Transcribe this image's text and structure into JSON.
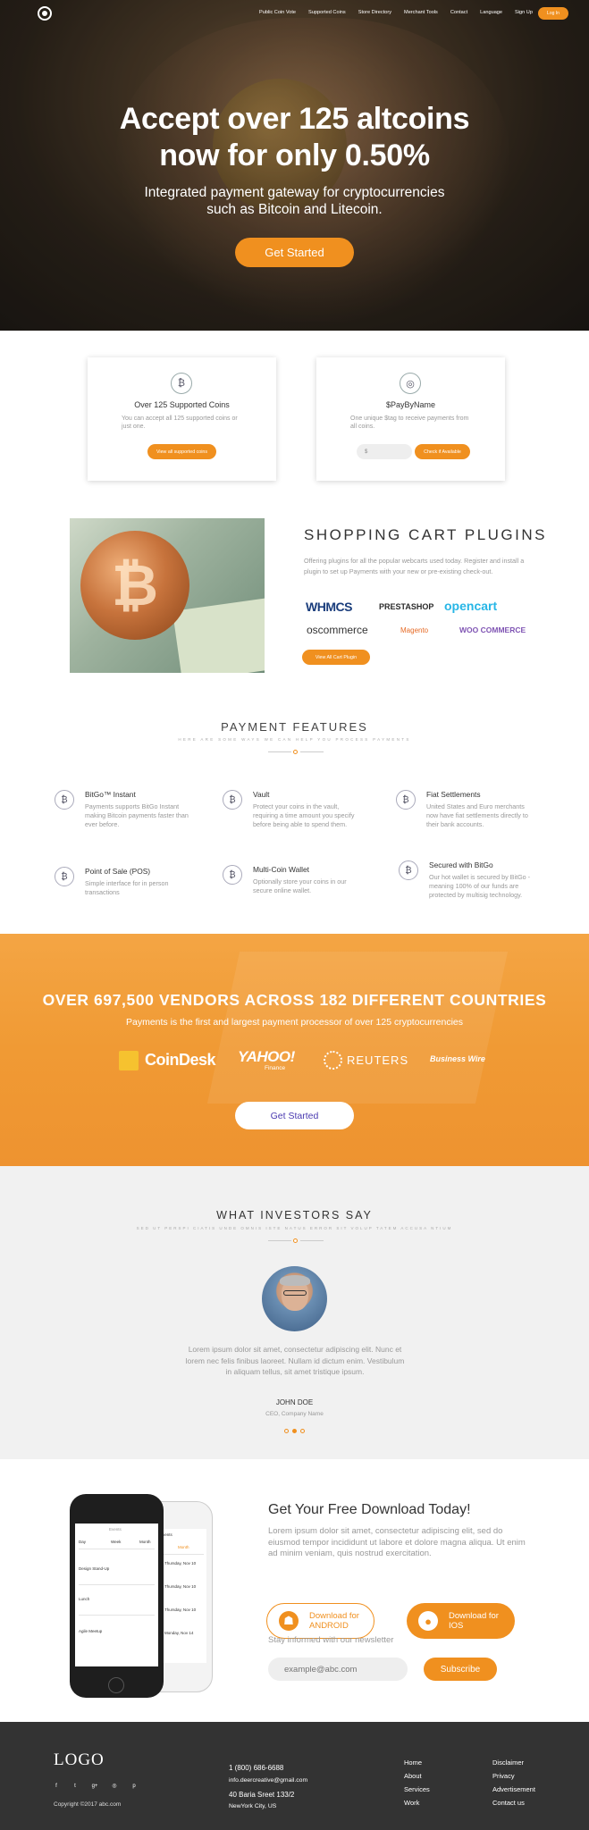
{
  "nav": {
    "links": [
      "Public Coin Vote",
      "Supported Coins",
      "Store Directory",
      "Merchant Tools",
      "Contact",
      "Language",
      "Sign Up"
    ],
    "login": "Log In"
  },
  "hero": {
    "title_line1": "Accept over 125 altcoins",
    "title_line2": "now for only 0.50%",
    "sub_line1": "Integrated payment gateway for cryptocurrencies",
    "sub_line2": "such as Bitcoin and Litecoin.",
    "cta": "Get Started"
  },
  "cards": [
    {
      "icon": "₿",
      "title": "Over 125 Supported Coins",
      "desc": "You can accept all 125 supported coins or just one.",
      "button": "View all supported coins"
    },
    {
      "icon": "◎",
      "title": "$PayByName",
      "desc": "One unique $tag to receive payments from all coins.",
      "field": "$",
      "button": "Check if Available"
    }
  ],
  "cart": {
    "title": "SHOPPING CART PLUGINS",
    "text": "Offering plugins for all the popular webcarts used today. Register and install a plugin to set up Payments with your new or pre-existing check-out.",
    "brands": [
      "WHMCS",
      "PRESTASHOP",
      "opencart",
      "oscommerce",
      "Magento",
      "WOO COMMERCE"
    ],
    "button": "View All Cart Plugin"
  },
  "features": {
    "title": "PAYMENT FEATURES",
    "subtitle": "HERE ARE SOME WAYS WE CAN HELP YOU PROCESS PAYMENTS",
    "items": [
      {
        "title": "BitGo™ Instant",
        "desc": "Payments supports BitGo Instant making Bitcoin payments faster than ever before."
      },
      {
        "title": "Vault",
        "desc": "Protect your coins in the vault, requiring a time amount you specify before being able to spend them."
      },
      {
        "title": "Fiat Settlements",
        "desc": "United States and Euro merchants now have fiat settlements directly to their bank accounts."
      },
      {
        "title": "Point of Sale (POS)",
        "desc": "Simple interface for in person transactions"
      },
      {
        "title": "Multi-Coin Wallet",
        "desc": "Optionally store your coins in our secure online wallet."
      },
      {
        "title": "Secured with BitGo",
        "desc": "Our hot wallet is secured by BitGo - meaning 100% of our funds are protected by multisig technology."
      }
    ]
  },
  "band": {
    "title": "OVER 697,500 VENDORS ACROSS 182 DIFFERENT COUNTRIES",
    "sub": "Payments is the first and largest payment processor of over 125 cryptocurrencies",
    "press": [
      "CoinDesk",
      "YAHOO!",
      "Finance",
      "REUTERS",
      "Business Wire"
    ],
    "cta": "Get Started"
  },
  "investors": {
    "title": "WHAT INVESTORS SAY",
    "subtitle": "SED UT PERSPI CIATIS UNDE OMNIS ISTE NATUS ERROR SIT VOLUP TATEM ACCUSA NTIUM",
    "quote": "Lorem ipsum dolor sit amet, consectetur adipiscing elit. Nunc et lorem nec felis finibus laoreet. Nullam id dictum enim. Vestibulum in aliquam tellus, sit amet tristique ipsum.",
    "name": "JOHN DOE",
    "role": "CEO, Company Name"
  },
  "phone_app": {
    "header": "Events",
    "tabs": [
      "Day",
      "Week",
      "Month"
    ],
    "rows": [
      "Design Stand-Up",
      "Lunch",
      "Agile Meetup"
    ],
    "back_rows": [
      "Thursday, Nov 10",
      "Thursday, Nov 10",
      "Thursday, Nov 10",
      "Monday, Nov 14"
    ]
  },
  "download": {
    "title": "Get Your Free Download Today!",
    "text": "Lorem ipsum dolor sit amet, consectetur adipiscing elit, sed do eiusmod tempor incididunt ut labore et dolore magna aliqua. Ut enim ad minim veniam, quis nostrud exercitation.",
    "android_l1": "Download for",
    "android_l2": "ANDROID",
    "ios_l1": "Download for",
    "ios_l2": "IOS",
    "newsletter": "Stay informed with our newsletter",
    "email_placeholder": "example@abc.com",
    "subscribe": "Subscribe"
  },
  "footer": {
    "logo": "LOGO",
    "social": [
      "f",
      "t",
      "g+",
      "◎",
      "p"
    ],
    "copyright": "Copyright ©2017 abc.com",
    "phone": "1 (800) 686-6688",
    "email": "info.deercreative@gmail.com",
    "address1": "40 Baria Sreet 133/2",
    "address2": "NewYork City, US",
    "col1": [
      "Home",
      "About",
      "Services",
      "Work"
    ],
    "col2": [
      "Disclaimer",
      "Privacy",
      "Advertisement",
      "Contact us"
    ]
  },
  "colors": {
    "accent": "#f0901f",
    "dark": "#333333",
    "light_bg": "#f1f1f1"
  }
}
